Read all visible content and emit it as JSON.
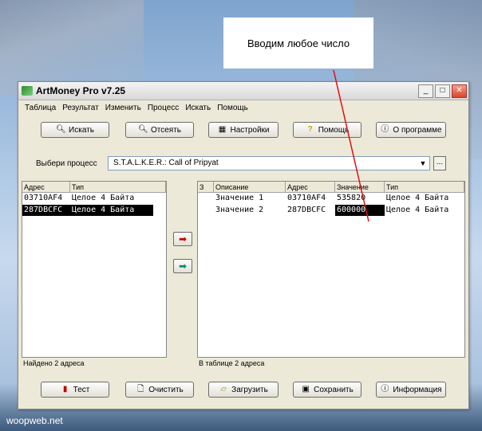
{
  "callout": {
    "text": "Вводим любое число"
  },
  "watermark": "woopweb.net",
  "window": {
    "title": "ArtMoney Pro v7.25",
    "buttons": {
      "minimize": "_",
      "maximize": "□",
      "close": "✕"
    }
  },
  "menu": [
    "Таблица",
    "Результат",
    "Изменить",
    "Процесс",
    "Искать",
    "Помощь"
  ],
  "toolbar": {
    "search": "Искать",
    "filter": "Отсеять",
    "settings": "Настройки",
    "help": "Помощь",
    "about": "О программе"
  },
  "process": {
    "label": "Выбери процесс",
    "value": "S.T.A.L.K.E.R.: Call of Pripyat",
    "extra": "..."
  },
  "left_table": {
    "headers": [
      "Адрес",
      "Тип"
    ],
    "rows": [
      {
        "address": "03710AF4",
        "type": "Целое 4 Байта",
        "selected": false
      },
      {
        "address": "287DBCFC",
        "type": "Целое 4 Байта",
        "selected": true
      }
    ],
    "status": "Найдено 2 адреса"
  },
  "right_table": {
    "headers": [
      "З",
      "Описание",
      "Адрес",
      "Значение",
      "Тип"
    ],
    "rows": [
      {
        "desc": "Значение 1",
        "address": "03710AF4",
        "value": "535820",
        "type": "Целое 4 Байта",
        "editing": false
      },
      {
        "desc": "Значение 2",
        "address": "287DBCFC",
        "value": "600000",
        "type": "Целое 4 Байта",
        "editing": true
      }
    ],
    "status": "В таблице 2 адреса"
  },
  "bottom": {
    "test": "Тест",
    "clear": "Очистить",
    "load": "Загрузить",
    "save": "Сохранить",
    "info": "Информация"
  },
  "colors": {
    "arrow": "#e01010",
    "accent_green": "#2c8a2c"
  }
}
